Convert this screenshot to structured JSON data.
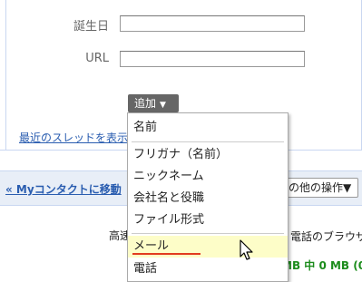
{
  "form": {
    "birthday_label": "誕生日",
    "url_label": "URL",
    "birthday_value": "",
    "url_value": "",
    "add_button_label": "追加",
    "add_caret": "▼"
  },
  "recent_thread_link": "最近のスレッドを表示",
  "action_bar": {
    "back_link": "« Myコンタクトに移動",
    "other_ops_label": "その他の操作▼"
  },
  "footer": {
    "text1": "高速",
    "text2": "電話のブラウザ",
    "storage": "MB 中 0 MB (0"
  },
  "dropdown": {
    "header": "名前",
    "items": [
      {
        "label": "フリガナ（名前）"
      },
      {
        "label": "ニックネーム"
      },
      {
        "label": "会社名と役職"
      },
      {
        "label": "ファイル形式"
      },
      {
        "label": "メール",
        "highlighted": true
      },
      {
        "label": "電話"
      }
    ]
  },
  "colors": {
    "link": "#2a5db0",
    "highlight": "#fdfdc8",
    "underline": "#e23b1f",
    "storage_green": "#1c8c1c"
  }
}
